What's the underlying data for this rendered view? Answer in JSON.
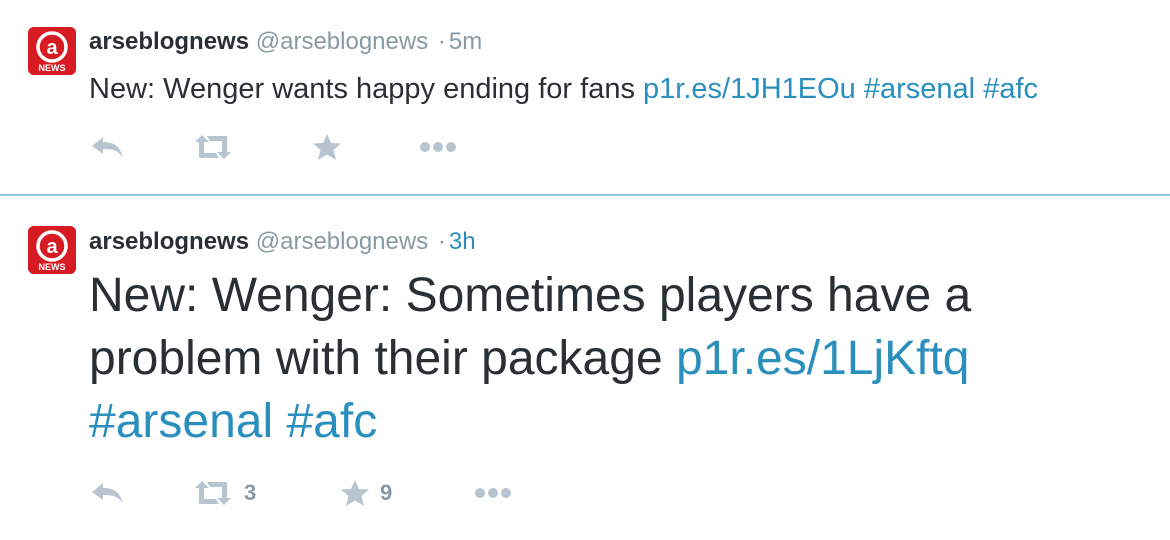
{
  "tweets": [
    {
      "fullname": "arseblognews",
      "username": "@arseblognews",
      "separator": "·",
      "time": "5m",
      "text_plain": "New: Wenger wants happy ending for fans ",
      "link": "p1r.es/1JH1EOu",
      "hashtags": [
        "#arsenal",
        "#afc"
      ],
      "retweet_count": "",
      "favorite_count": ""
    },
    {
      "fullname": "arseblognews",
      "username": "@arseblognews",
      "separator": "·",
      "time": "3h",
      "text_plain": "New: Wenger: Sometimes players have a problem with their package ",
      "link": "p1r.es/1LjKftq",
      "hashtags": [
        "#arsenal",
        "#afc"
      ],
      "retweet_count": "3",
      "favorite_count": "9"
    }
  ],
  "avatar": {
    "logo_text": "NEWS",
    "logo_letter": "a",
    "brand_color": "#d61b22"
  },
  "icons": {
    "reply": "reply-icon",
    "retweet": "retweet-icon",
    "favorite": "star-icon",
    "more": "more-icon"
  },
  "colors": {
    "link": "#2a8fbd",
    "muted": "#8899a6",
    "text": "#292f33",
    "divider": "#8ec5e0"
  }
}
